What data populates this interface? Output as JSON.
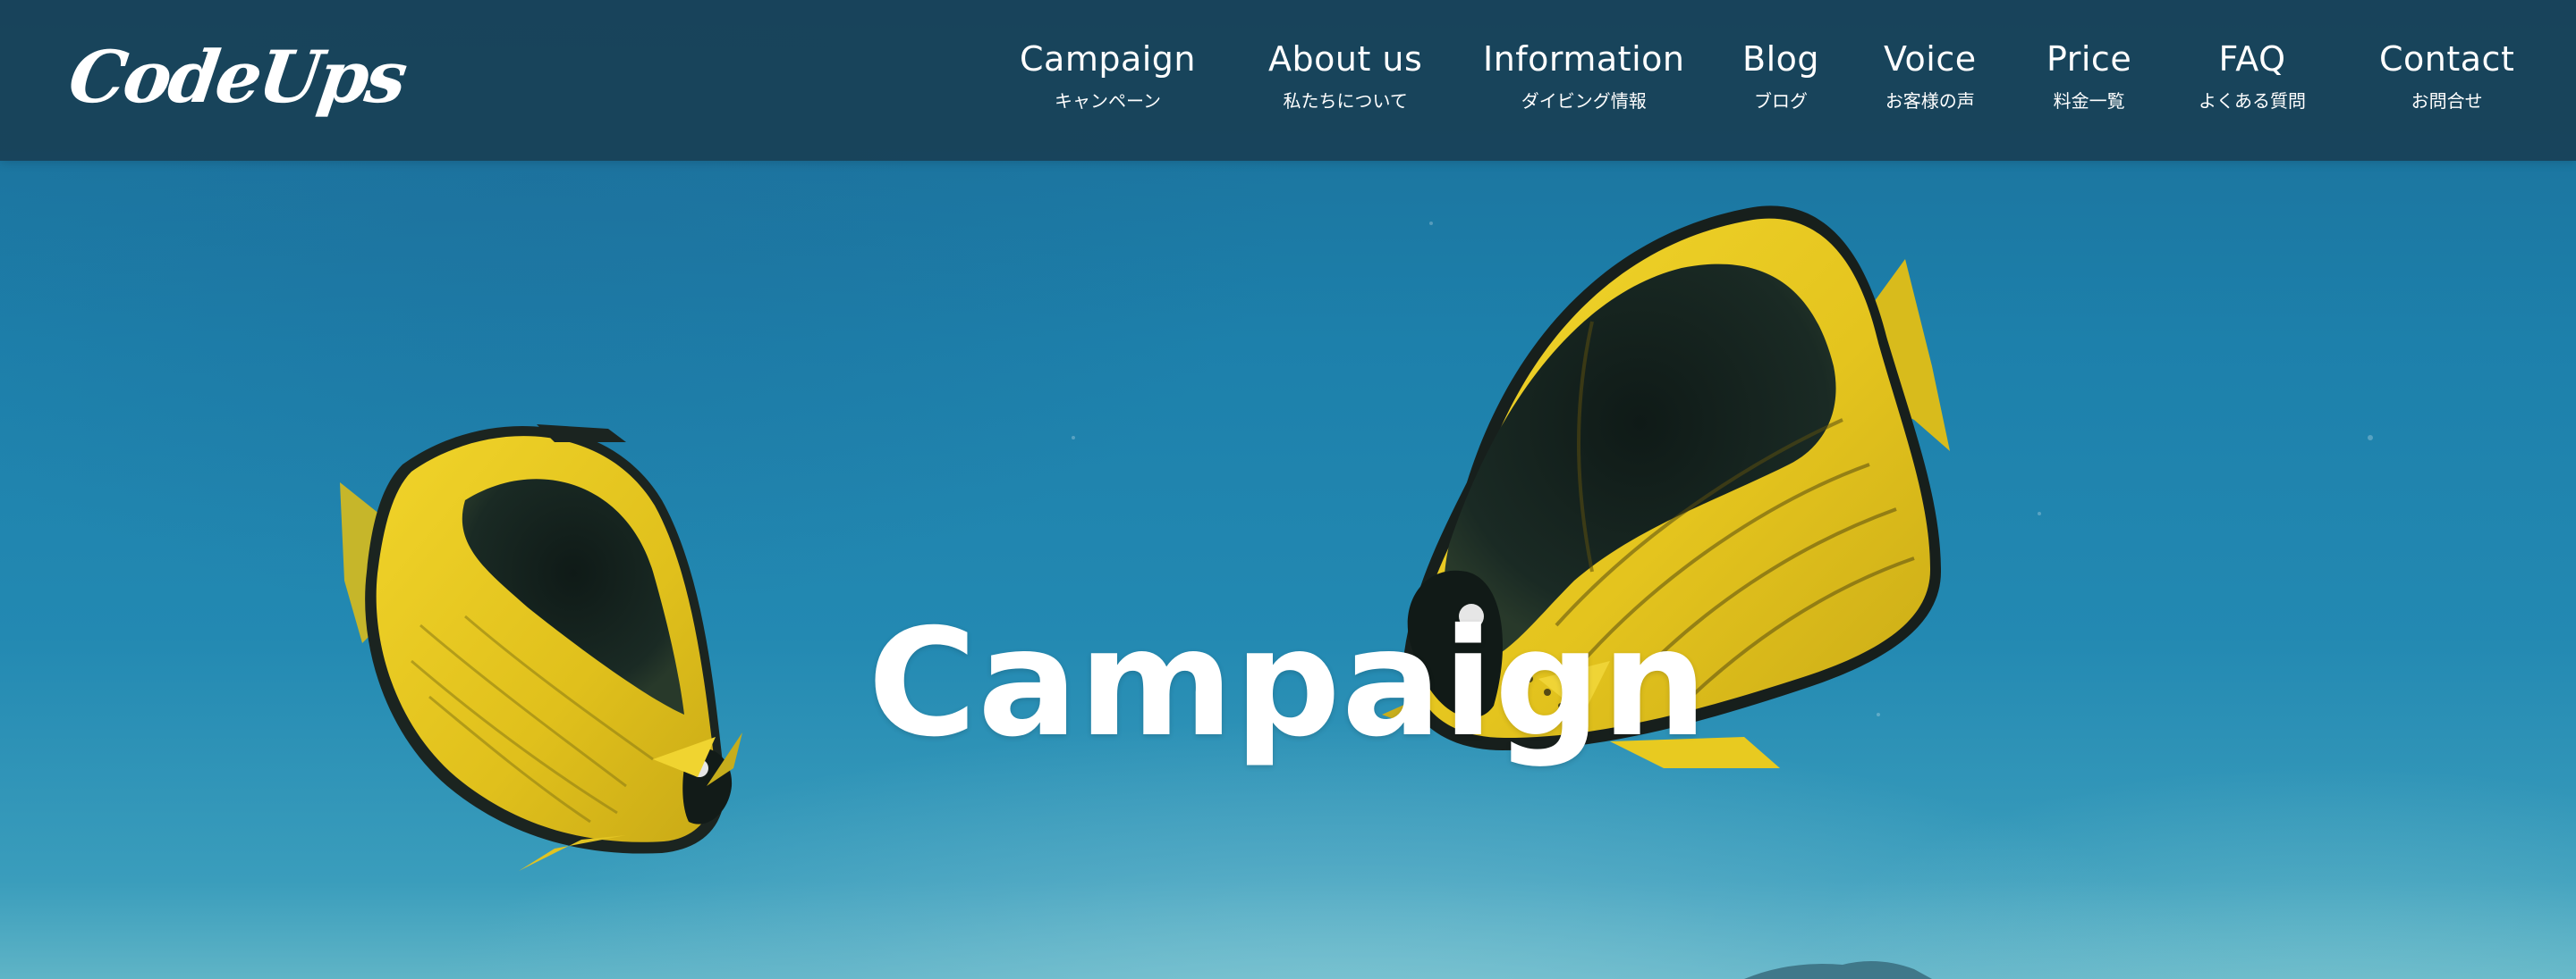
{
  "header": {
    "logo": "CodeUps",
    "nav": [
      {
        "en": "Campaign",
        "jp": "キャンペーン"
      },
      {
        "en": "About us",
        "jp": "私たちについて"
      },
      {
        "en": "Information",
        "jp": "ダイビング情報"
      },
      {
        "en": "Blog",
        "jp": "ブログ"
      },
      {
        "en": "Voice",
        "jp": "お客様の声"
      },
      {
        "en": "Price",
        "jp": "料金一覧"
      },
      {
        "en": "FAQ",
        "jp": "よくある質問"
      },
      {
        "en": "Contact",
        "jp": "お問合せ"
      }
    ]
  },
  "hero": {
    "title": "Campaign",
    "image": "butterflyfish-underwater-photo"
  },
  "colors": {
    "header_bg": "#183e52",
    "ocean": "#1f7fa8",
    "fish_yellow": "#e8c81e",
    "fish_dark": "#16221f",
    "text": "#ffffff"
  }
}
